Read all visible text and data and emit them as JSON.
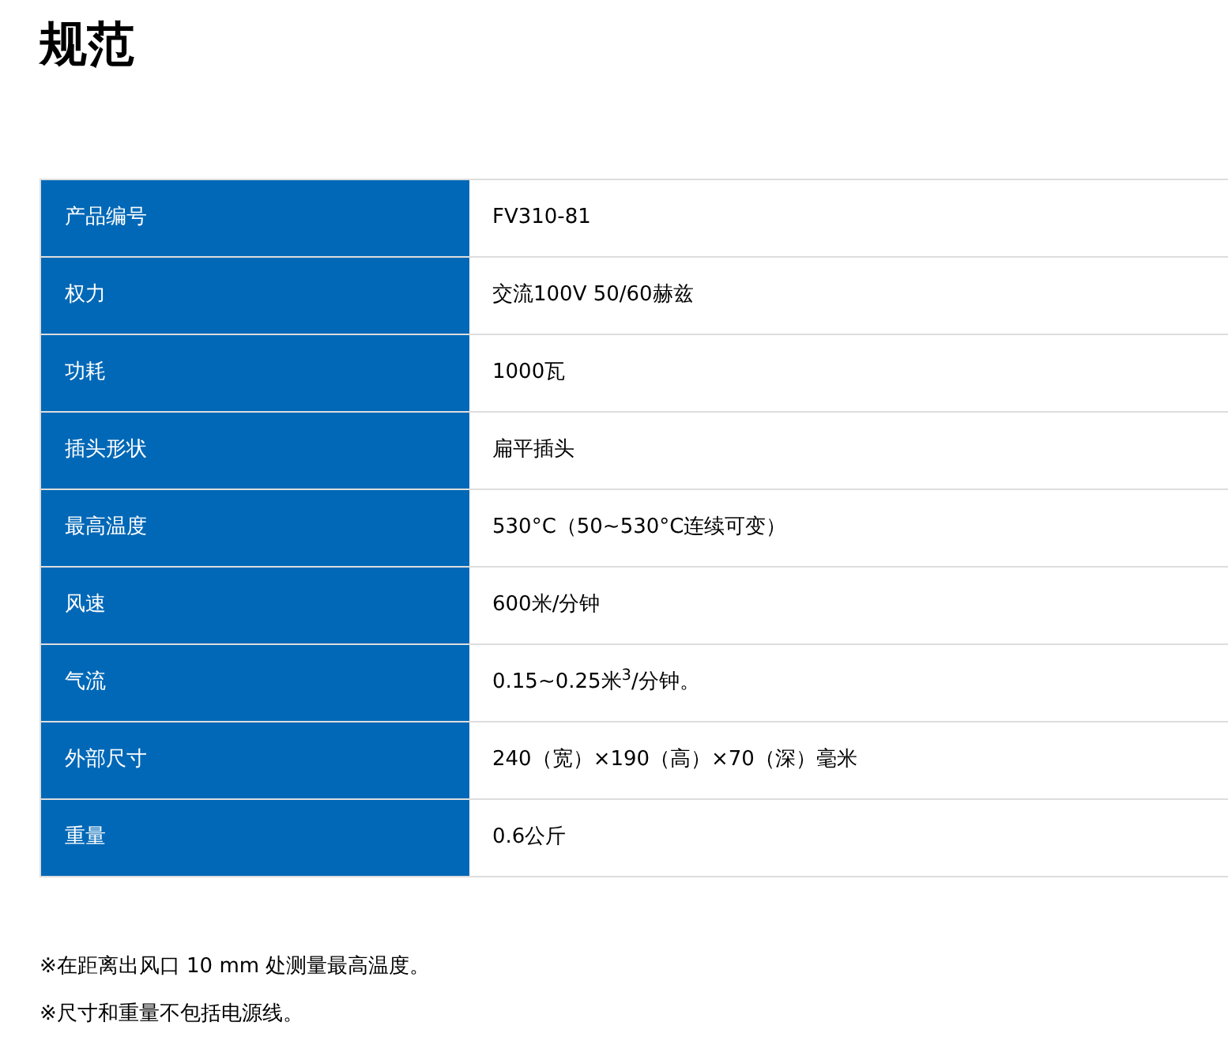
{
  "title": "规范",
  "specs": [
    {
      "label": "产品编号",
      "value": "FV310-81"
    },
    {
      "label": "权力",
      "value": "交流100V 50/60赫兹"
    },
    {
      "label": "功耗",
      "value": "1000瓦"
    },
    {
      "label": "插头形状",
      "value": "扁平插头"
    },
    {
      "label": "最高温度",
      "value": "530°C（50~530°C连续可变）"
    },
    {
      "label": "风速",
      "value": "600米/分钟"
    },
    {
      "label": "气流",
      "value": "0.15~0.25米$^{3}$/分钟。"
    },
    {
      "label": "外部尺寸",
      "value": "240（宽）×190（高）×70（深）毫米"
    },
    {
      "label": "重量",
      "value": "0.6公斤"
    }
  ],
  "notes": [
    "※在距离出风口 10 mm 处测量最高温度。",
    "※尺寸和重量不包括电源线。"
  ]
}
